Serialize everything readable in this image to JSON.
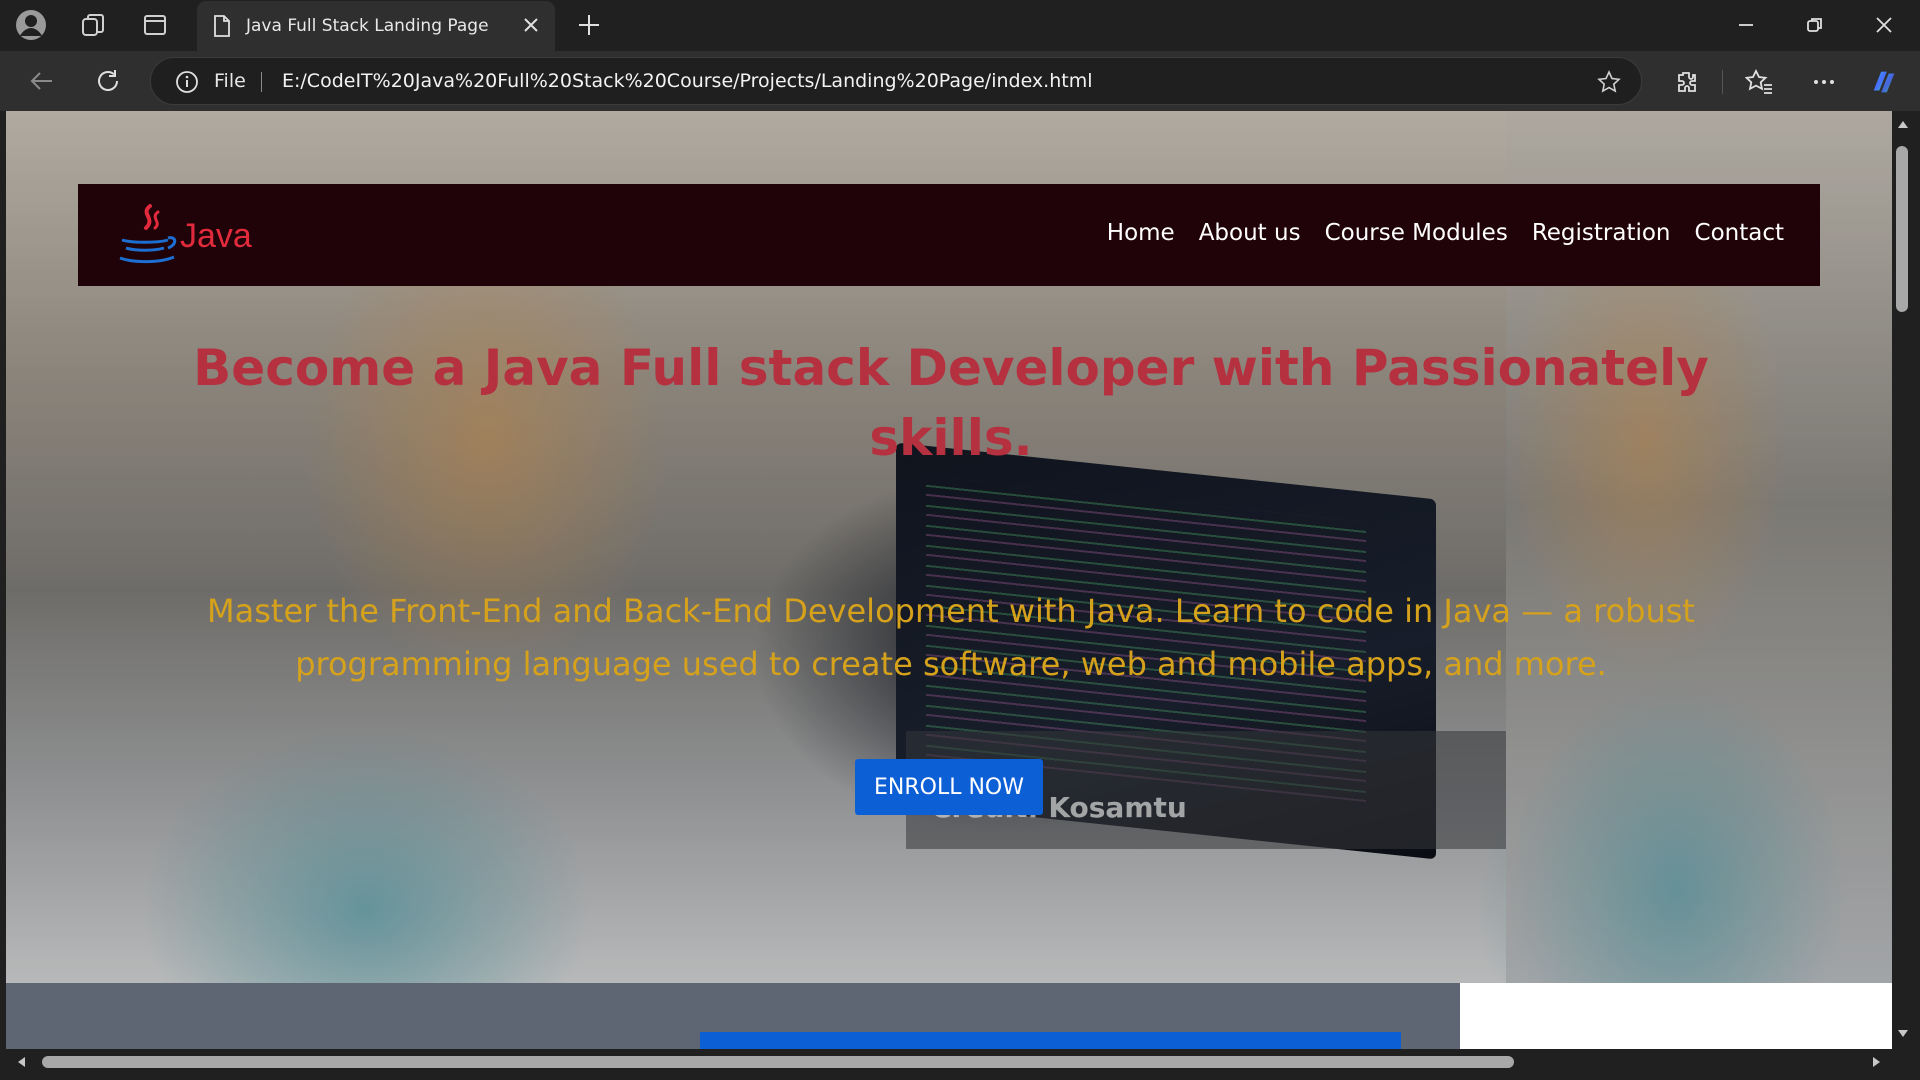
{
  "browser": {
    "tab_title": "Java Full Stack Landing Page",
    "omnibox_scheme": "File",
    "url": "E:/CodeIT%20Java%20Full%20Stack%20Course/Projects/Landing%20Page/index.html",
    "icons": [
      "profile-icon",
      "workspaces-icon",
      "tab-actions-icon",
      "document-icon",
      "close-icon",
      "new-tab-icon",
      "minimize-icon",
      "restore-icon",
      "window-close-icon",
      "back-icon",
      "refresh-icon",
      "info-icon",
      "favorite-star-icon",
      "extensions-icon",
      "favorites-icon",
      "more-icon",
      "copilot-icon"
    ]
  },
  "page": {
    "brand": {
      "logo_text": "Java"
    },
    "nav": [
      "Home",
      "About us",
      "Course Modules",
      "Registration",
      "Contact"
    ],
    "hero": {
      "headline": "Become a Java Full stack Developer with Passionately skills.",
      "subheadline": "Master the Front-End and Back-End Development with Java. Learn to code in Java — a robust programming language used to create software, web and mobile apps, and more.",
      "cta": "ENROLL NOW",
      "image_credit": "Credit: Kosamtu"
    },
    "colors": {
      "navbar_bg": "#200309",
      "headline": "#b5313f",
      "subheadline": "#d6a21c",
      "cta_bg": "#0d5fd6"
    }
  }
}
